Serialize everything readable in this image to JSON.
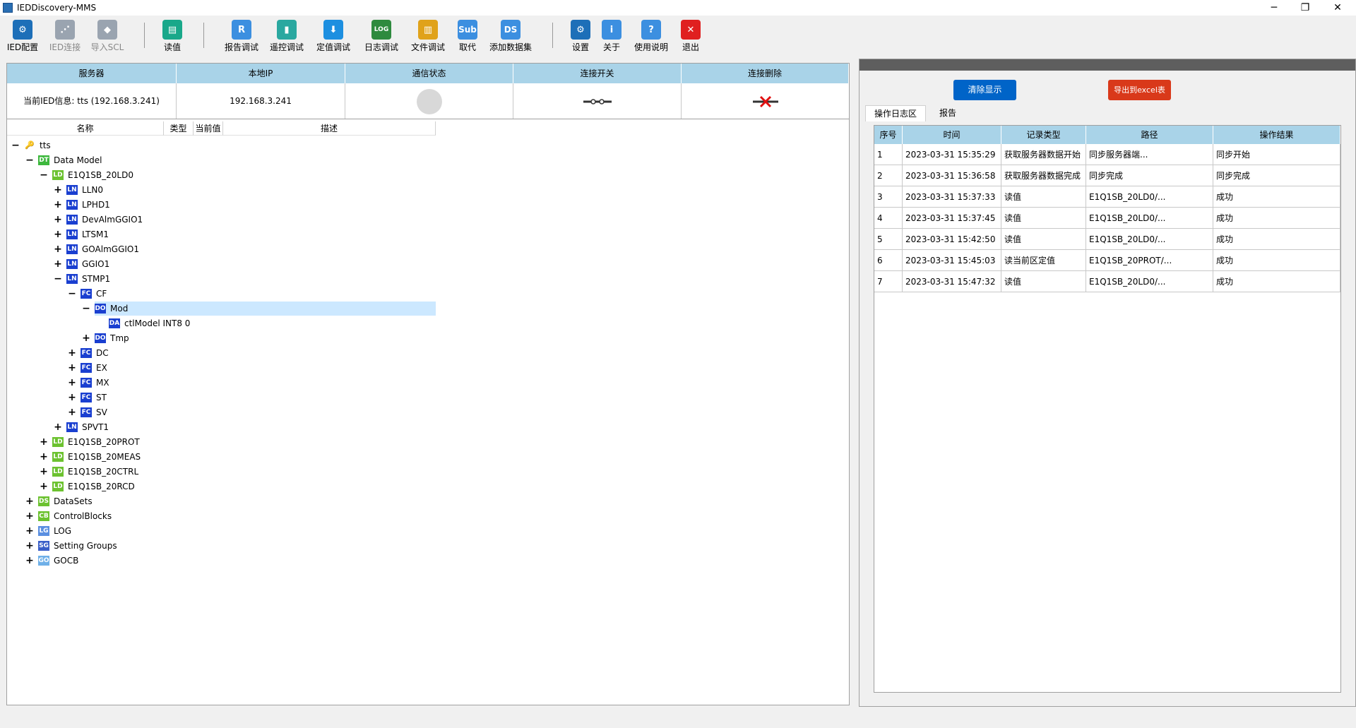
{
  "window": {
    "title": "IEDDiscovery-MMS",
    "minimize": "─",
    "maximize": "❐",
    "close": "✕"
  },
  "toolbar": [
    {
      "label": "IED配置",
      "icon": "gear-network-icon",
      "color": "#1d6fb8",
      "glyph": "⚙",
      "disabled": false
    },
    {
      "label": "IED连接",
      "icon": "network-nodes-icon",
      "color": "#9aa4b0",
      "glyph": "⋰",
      "disabled": true
    },
    {
      "label": "导入SCL",
      "icon": "import-diamond-icon",
      "color": "#9aa4b0",
      "glyph": "◆",
      "disabled": true
    },
    {
      "label": "读值",
      "icon": "read-book-icon",
      "color": "#19a88a",
      "glyph": "▤",
      "disabled": false
    },
    {
      "label": "报告调试",
      "icon": "report-r-icon",
      "color": "#3c8fe0",
      "glyph": "R",
      "disabled": false
    },
    {
      "label": "遥控调试",
      "icon": "remote-control-icon",
      "color": "#2aa8a0",
      "glyph": "▮",
      "disabled": false
    },
    {
      "label": "定值调试",
      "icon": "pin-icon",
      "color": "#1d8fe0",
      "glyph": "⬇",
      "disabled": false
    },
    {
      "label": "日志调试",
      "icon": "log-icon",
      "color": "#2e8a3e",
      "glyph": "LOG",
      "disabled": false
    },
    {
      "label": "文件调试",
      "icon": "file-folder-icon",
      "color": "#e0a21a",
      "glyph": "▥",
      "disabled": false
    },
    {
      "label": "取代",
      "icon": "sub-icon",
      "color": "#3c8fe0",
      "glyph": "Sub",
      "disabled": false
    },
    {
      "label": "添加数据集",
      "icon": "dataset-add-icon",
      "color": "#3c8fe0",
      "glyph": "DS",
      "disabled": false
    },
    {
      "label": "设置",
      "icon": "settings-gear-icon",
      "color": "#1d6fb8",
      "glyph": "⚙",
      "disabled": false
    },
    {
      "label": "关于",
      "icon": "info-icon",
      "color": "#3c8fe0",
      "glyph": "i",
      "disabled": false
    },
    {
      "label": "使用说明",
      "icon": "help-icon",
      "color": "#3c8fe0",
      "glyph": "?",
      "disabled": false
    },
    {
      "label": "退出",
      "icon": "exit-x-icon",
      "color": "#e02020",
      "glyph": "✕",
      "disabled": false
    }
  ],
  "server_table": {
    "headers": [
      "服务器",
      "本地IP",
      "通信状态",
      "连接开关",
      "连接删除"
    ],
    "row": {
      "server": "当前IED信息: tts (192.168.3.241)",
      "local_ip": "192.168.3.241"
    }
  },
  "tree_headers": [
    "名称",
    "类型",
    "当前值",
    "描述"
  ],
  "tree": [
    {
      "label": "tts",
      "badge": "key",
      "depth": 0,
      "toggle": "−"
    },
    {
      "label": "Data Model",
      "badge": "DT",
      "depth": 1,
      "toggle": "−"
    },
    {
      "label": "E1Q1SB_20LD0",
      "badge": "LD",
      "depth": 2,
      "toggle": "−"
    },
    {
      "label": "LLN0",
      "badge": "LN",
      "depth": 3,
      "toggle": "+"
    },
    {
      "label": "LPHD1",
      "badge": "LN",
      "depth": 3,
      "toggle": "+"
    },
    {
      "label": "DevAlmGGIO1",
      "badge": "LN",
      "depth": 3,
      "toggle": "+"
    },
    {
      "label": "LTSM1",
      "badge": "LN",
      "depth": 3,
      "toggle": "+"
    },
    {
      "label": "GOAlmGGIO1",
      "badge": "LN",
      "depth": 3,
      "toggle": "+"
    },
    {
      "label": "GGIO1",
      "badge": "LN",
      "depth": 3,
      "toggle": "+"
    },
    {
      "label": "STMP1",
      "badge": "LN",
      "depth": 3,
      "toggle": "−"
    },
    {
      "label": "CF",
      "badge": "FC",
      "depth": 4,
      "toggle": "−"
    },
    {
      "label": "Mod",
      "badge": "DO",
      "depth": 5,
      "toggle": "−",
      "selected": true
    },
    {
      "label": "ctlModel  INT8  0",
      "badge": "DA",
      "depth": 6,
      "toggle": ""
    },
    {
      "label": "Tmp",
      "badge": "DO",
      "depth": 5,
      "toggle": "+"
    },
    {
      "label": "DC",
      "badge": "FC",
      "depth": 4,
      "toggle": "+"
    },
    {
      "label": "EX",
      "badge": "FC",
      "depth": 4,
      "toggle": "+"
    },
    {
      "label": "MX",
      "badge": "FC",
      "depth": 4,
      "toggle": "+"
    },
    {
      "label": "ST",
      "badge": "FC",
      "depth": 4,
      "toggle": "+"
    },
    {
      "label": "SV",
      "badge": "FC",
      "depth": 4,
      "toggle": "+"
    },
    {
      "label": "SPVT1",
      "badge": "LN",
      "depth": 3,
      "toggle": "+"
    },
    {
      "label": "E1Q1SB_20PROT",
      "badge": "LD",
      "depth": 2,
      "toggle": "+"
    },
    {
      "label": "E1Q1SB_20MEAS",
      "badge": "LD",
      "depth": 2,
      "toggle": "+"
    },
    {
      "label": "E1Q1SB_20CTRL",
      "badge": "LD",
      "depth": 2,
      "toggle": "+"
    },
    {
      "label": "E1Q1SB_20RCD",
      "badge": "LD",
      "depth": 2,
      "toggle": "+"
    },
    {
      "label": "DataSets",
      "badge": "DS",
      "depth": 1,
      "toggle": "+"
    },
    {
      "label": "ControlBlocks",
      "badge": "CB",
      "depth": 1,
      "toggle": "+"
    },
    {
      "label": "LOG",
      "badge": "LG",
      "depth": 1,
      "toggle": "+"
    },
    {
      "label": "Setting Groups",
      "badge": "SG",
      "depth": 1,
      "toggle": "+"
    },
    {
      "label": "GOCB",
      "badge": "GO",
      "depth": 1,
      "toggle": "+"
    }
  ],
  "badge_colors": {
    "DT": "#3db83d",
    "LD": "#6cc230",
    "LN": "#1a3fd0",
    "FC": "#1a3fd0",
    "DO": "#1a3fd0",
    "DA": "#1a3fd0",
    "DS": "#6cc230",
    "CB": "#6cc230",
    "LG": "#5b8fe0",
    "SG": "#3a5fc8",
    "GO": "#6fb0e8"
  },
  "right": {
    "clear_button": "清除显示",
    "export_button": "导出到excel表",
    "tabs": [
      "操作日志区",
      "报告"
    ],
    "log_headers": [
      "序号",
      "时间",
      "记录类型",
      "路径",
      "操作结果"
    ],
    "log_rows": [
      [
        "1",
        "2023-03-31 15:35:29",
        "获取服务器数据开始",
        "同步服务器端...",
        "同步开始"
      ],
      [
        "2",
        "2023-03-31 15:36:58",
        "获取服务器数据完成",
        "同步完成",
        "同步完成"
      ],
      [
        "3",
        "2023-03-31 15:37:33",
        "读值",
        "E1Q1SB_20LD0/...",
        "成功"
      ],
      [
        "4",
        "2023-03-31 15:37:45",
        "读值",
        "E1Q1SB_20LD0/...",
        "成功"
      ],
      [
        "5",
        "2023-03-31 15:42:50",
        "读值",
        "E1Q1SB_20LD0/...",
        "成功"
      ],
      [
        "6",
        "2023-03-31 15:45:03",
        "读当前区定值",
        "E1Q1SB_20PROT/...",
        "成功"
      ],
      [
        "7",
        "2023-03-31 15:47:32",
        "读值",
        "E1Q1SB_20LD0/...",
        "成功"
      ]
    ]
  }
}
